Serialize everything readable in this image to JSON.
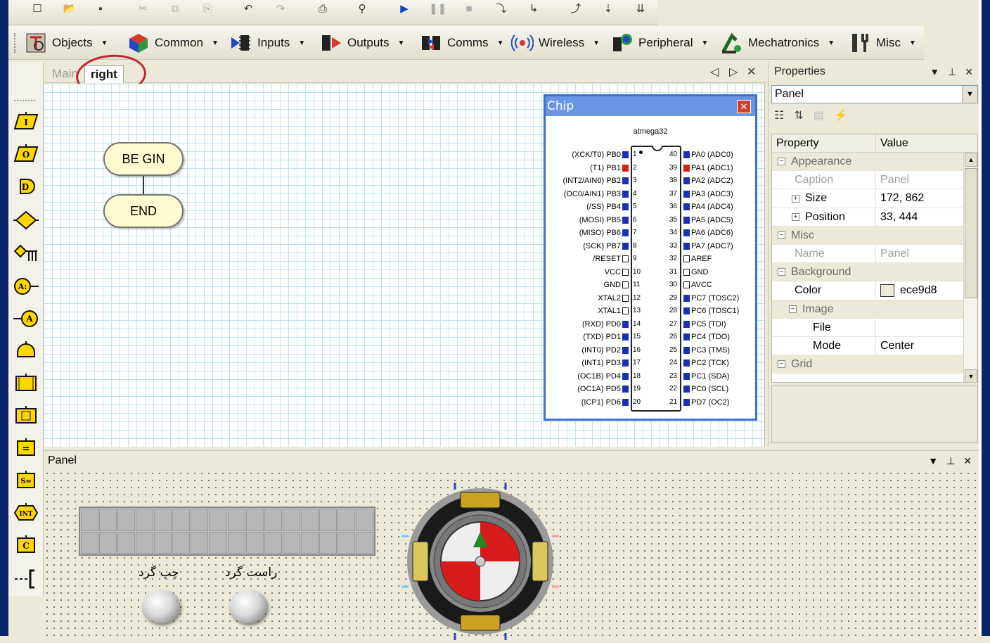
{
  "toolbar_top": {
    "icons": [
      "new-icon",
      "open-icon",
      "save-icon",
      "cut-icon",
      "copy-icon",
      "paste-icon",
      "undo-icon",
      "redo-icon",
      "print-icon",
      "debug-icon",
      "run-icon",
      "pause-icon",
      "stop-icon",
      "step-into-icon",
      "step-over-icon",
      "step-out-icon",
      "step-icon",
      "step2-icon"
    ]
  },
  "toolbar_components": {
    "menus": [
      {
        "label": "Objects",
        "icon": "objects-icon"
      },
      {
        "label": "Common",
        "icon": "common-icon"
      },
      {
        "label": "Inputs",
        "icon": "inputs-icon"
      },
      {
        "label": "Outputs",
        "icon": "outputs-icon"
      },
      {
        "label": "Comms",
        "icon": "comms-icon"
      },
      {
        "label": "Wireless",
        "icon": "wireless-icon"
      },
      {
        "label": "Peripheral",
        "icon": "peripheral-icon"
      },
      {
        "label": "Mechatronics",
        "icon": "mechatronics-icon"
      },
      {
        "label": "Misc",
        "icon": "misc-icon"
      }
    ]
  },
  "flow_symbols": [
    {
      "name": "input-symbol",
      "label": "I"
    },
    {
      "name": "output-symbol",
      "label": "O"
    },
    {
      "name": "delay-symbol",
      "label": "D"
    },
    {
      "name": "decision-symbol",
      "label": ""
    },
    {
      "name": "switch-symbol",
      "label": ""
    },
    {
      "name": "calc-assign-symbol",
      "label": "A:"
    },
    {
      "name": "component-macro-symbol",
      "label": "A"
    },
    {
      "name": "loop-symbol",
      "label": ""
    },
    {
      "name": "macro-symbol",
      "label": ""
    },
    {
      "name": "component-symbol",
      "label": ""
    },
    {
      "name": "calculation-symbol",
      "label": "="
    },
    {
      "name": "string-symbol",
      "label": "S="
    },
    {
      "name": "interrupt-symbol",
      "label": "INT"
    },
    {
      "name": "c-code-symbol",
      "label": "C"
    },
    {
      "name": "comment-symbol",
      "label": "--["
    }
  ],
  "tabs": {
    "items": [
      {
        "label": "Main",
        "active": false
      },
      {
        "label": "right",
        "active": true
      }
    ]
  },
  "flowchart": {
    "begin": "BE GIN",
    "end": "END"
  },
  "chip": {
    "title": "Chip",
    "close": "✕",
    "name": "atmega32",
    "left_pins": [
      {
        "label": "(XCK/T0) PB0",
        "num": "1",
        "state": "blue"
      },
      {
        "label": "(T1) PB1",
        "num": "2",
        "state": "red"
      },
      {
        "label": "(INT2/AIN0) PB2",
        "num": "3",
        "state": "blue"
      },
      {
        "label": "(OC0/AIN1) PB3",
        "num": "4",
        "state": "blue"
      },
      {
        "label": "(/SS) PB4",
        "num": "5",
        "state": "blue"
      },
      {
        "label": "(MOSI) PB5",
        "num": "6",
        "state": "blue"
      },
      {
        "label": "(MISO) PB6",
        "num": "7",
        "state": "blue"
      },
      {
        "label": "(SCK) PB7",
        "num": "8",
        "state": "blue"
      },
      {
        "label": "/RESET",
        "num": "9",
        "state": "empty"
      },
      {
        "label": "VCC",
        "num": "10",
        "state": "empty"
      },
      {
        "label": "GND",
        "num": "11",
        "state": "empty"
      },
      {
        "label": "XTAL2",
        "num": "12",
        "state": "empty"
      },
      {
        "label": "XTAL1",
        "num": "13",
        "state": "empty"
      },
      {
        "label": "(RXD) PD0",
        "num": "14",
        "state": "blue"
      },
      {
        "label": "(TXD) PD1",
        "num": "15",
        "state": "blue"
      },
      {
        "label": "(INT0) PD2",
        "num": "16",
        "state": "blue"
      },
      {
        "label": "(INT1) PD3",
        "num": "17",
        "state": "blue"
      },
      {
        "label": "(OC1B) PD4",
        "num": "18",
        "state": "blue"
      },
      {
        "label": "(OC1A) PD5",
        "num": "19",
        "state": "blue"
      },
      {
        "label": "(ICP1) PD6",
        "num": "20",
        "state": "blue"
      }
    ],
    "right_pins": [
      {
        "label": "PA0 (ADC0)",
        "num": "40",
        "state": "blue"
      },
      {
        "label": "PA1 (ADC1)",
        "num": "39",
        "state": "red"
      },
      {
        "label": "PA2 (ADC2)",
        "num": "38",
        "state": "blue"
      },
      {
        "label": "PA3 (ADC3)",
        "num": "37",
        "state": "blue"
      },
      {
        "label": "PA4 (ADC4)",
        "num": "36",
        "state": "blue"
      },
      {
        "label": "PA5 (ADC5)",
        "num": "35",
        "state": "blue"
      },
      {
        "label": "PA6 (ADC6)",
        "num": "34",
        "state": "blue"
      },
      {
        "label": "PA7 (ADC7)",
        "num": "33",
        "state": "blue"
      },
      {
        "label": "AREF",
        "num": "32",
        "state": "empty"
      },
      {
        "label": "GND",
        "num": "31",
        "state": "empty"
      },
      {
        "label": "AVCC",
        "num": "30",
        "state": "empty"
      },
      {
        "label": "PC7 (TOSC2)",
        "num": "29",
        "state": "blue"
      },
      {
        "label": "PC6 (TOSC1)",
        "num": "28",
        "state": "blue"
      },
      {
        "label": "PC5 (TDI)",
        "num": "27",
        "state": "blue"
      },
      {
        "label": "PC4 (TDO)",
        "num": "26",
        "state": "blue"
      },
      {
        "label": "PC3 (TMS)",
        "num": "25",
        "state": "blue"
      },
      {
        "label": "PC2 (TCK)",
        "num": "24",
        "state": "blue"
      },
      {
        "label": "PC1 (SDA)",
        "num": "23",
        "state": "blue"
      },
      {
        "label": "PC0 (SCL)",
        "num": "22",
        "state": "blue"
      },
      {
        "label": "PD7 (OC2)",
        "num": "21",
        "state": "blue"
      }
    ]
  },
  "properties": {
    "title": "Properties",
    "selected_object": "Panel",
    "col_property": "Property",
    "col_value": "Value",
    "rows": [
      {
        "type": "cat",
        "label": "Appearance",
        "value": ""
      },
      {
        "type": "dim",
        "label": "Caption",
        "value": "Panel"
      },
      {
        "type": "expand",
        "label": "Size",
        "value": "172, 862"
      },
      {
        "type": "expand",
        "label": "Position",
        "value": "33, 444"
      },
      {
        "type": "cat",
        "label": "Misc",
        "value": ""
      },
      {
        "type": "dim",
        "label": "Name",
        "value": "Panel"
      },
      {
        "type": "cat",
        "label": "Background",
        "value": ""
      },
      {
        "type": "color",
        "label": "Color",
        "value": "ece9d8"
      },
      {
        "type": "subcat",
        "label": "Image",
        "value": ""
      },
      {
        "type": "sub",
        "label": "File",
        "value": ""
      },
      {
        "type": "sub",
        "label": "Mode",
        "value": "Center"
      },
      {
        "type": "cat",
        "label": "Grid",
        "value": ""
      }
    ],
    "colors": {
      "panel_color": "#ece9d8"
    }
  },
  "panel": {
    "title": "Panel",
    "button_left_label": "چپ گرد",
    "button_right_label": "راست گرد"
  },
  "colors": {
    "frame_blue": "#0a246a",
    "chip_title": "#6b96e6",
    "pin_blue": "#1a2fb8",
    "pin_red": "#d81b1b",
    "annotation_red": "#c0242c"
  }
}
